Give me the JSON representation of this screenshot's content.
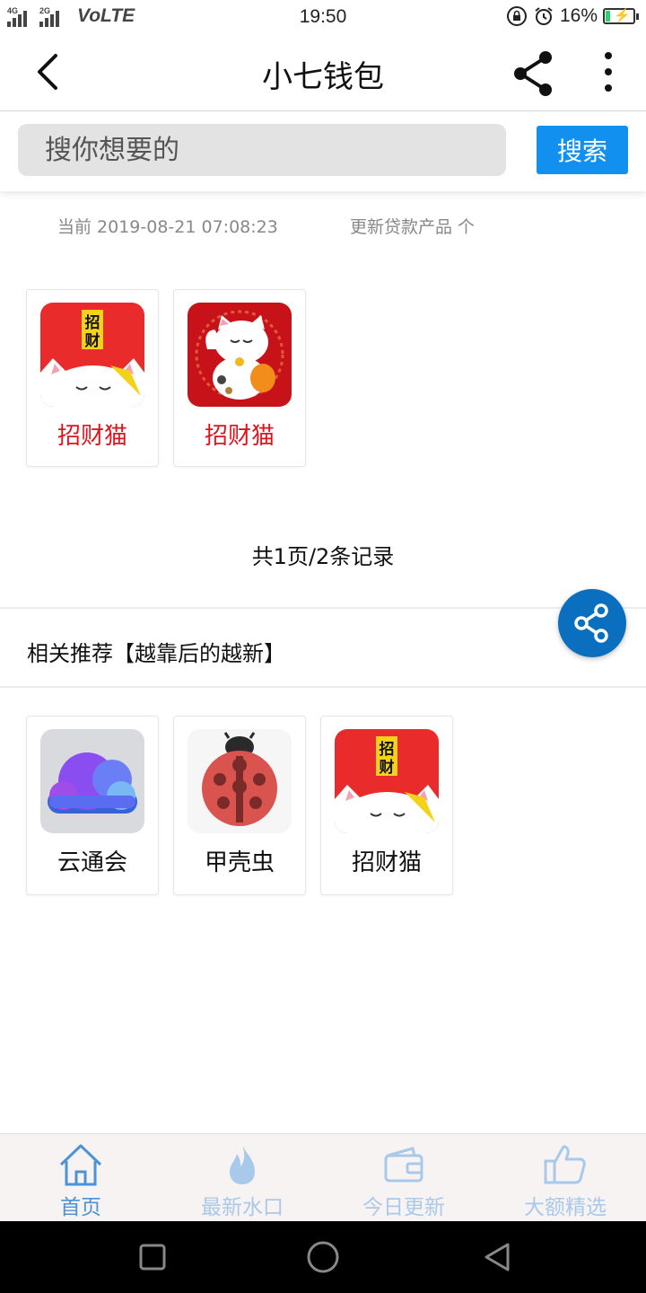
{
  "status_bar": {
    "network_1": "4G",
    "network_2": "2G",
    "volte": "VoLTE",
    "time": "19:50",
    "battery": "16%",
    "battery_level": 0.16
  },
  "header": {
    "title": "小七钱包"
  },
  "search": {
    "placeholder": "搜你想要的",
    "button_label": "搜索"
  },
  "info": {
    "current_time": "当前 2019-08-21 07:08:23",
    "update_text": "更新贷款产品 个"
  },
  "products": [
    {
      "name": "招财猫",
      "icon": "zhaocaimao-red-icon"
    },
    {
      "name": "招财猫",
      "icon": "lucky-cat-icon"
    }
  ],
  "records_text": "共1页/2条记录",
  "related": {
    "heading": "相关推荐【越靠后的越新】",
    "items": [
      {
        "name": "云通会",
        "icon": "cloud-icon"
      },
      {
        "name": "甲壳虫",
        "icon": "ladybug-icon"
      },
      {
        "name": "招财猫",
        "icon": "zhaocaimao-red-icon"
      }
    ]
  },
  "bottom_nav": {
    "items": [
      {
        "label": "首页",
        "icon": "home-icon",
        "active": true
      },
      {
        "label": "最新水口",
        "icon": "fire-icon",
        "active": false
      },
      {
        "label": "今日更新",
        "icon": "wallet-icon",
        "active": false
      },
      {
        "label": "大额精选",
        "icon": "thumbs-up-icon",
        "active": false
      }
    ]
  },
  "colors": {
    "accent": "#1190f0",
    "fab": "#0b6fc0",
    "product_name": "#e0141e",
    "nav_active": "#4b93d6",
    "nav_inactive": "#a9c9ea"
  }
}
